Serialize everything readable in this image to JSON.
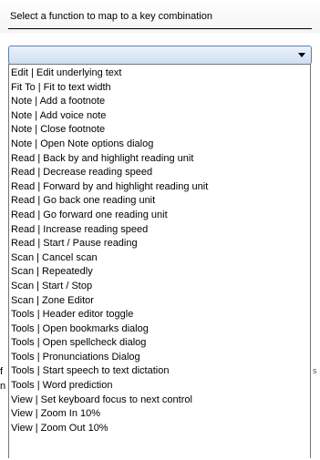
{
  "header": {
    "instruction": "Select a function to map to a key combination"
  },
  "combo": {
    "selected_value": "",
    "arrow_icon": "chevron-down-icon"
  },
  "behind": {
    "left_chars": [
      "f",
      "n"
    ],
    "right_char": "s"
  },
  "dropdown": {
    "items": [
      "Edit | Edit underlying text",
      "Fit To | Fit to text width",
      "Note | Add a footnote",
      "Note | Add voice note",
      "Note | Close footnote",
      "Note | Open Note options dialog",
      "Read | Back by and highlight reading unit",
      "Read | Decrease reading speed",
      "Read | Forward by and highlight reading unit",
      "Read | Go back one reading unit",
      "Read | Go forward one reading unit",
      "Read | Increase reading speed",
      "Read | Start / Pause reading",
      "Scan | Cancel scan",
      "Scan | Repeatedly",
      "Scan | Start / Stop",
      "Scan | Zone Editor",
      "Tools | Header editor toggle",
      "Tools | Open bookmarks dialog",
      "Tools | Open spellcheck dialog",
      "Tools | Pronunciations Dialog",
      "Tools | Start speech to text dictation",
      "Tools | Word prediction",
      "View | Set keyboard focus to next control",
      "View | Zoom In 10%",
      "View | Zoom Out 10%"
    ]
  }
}
